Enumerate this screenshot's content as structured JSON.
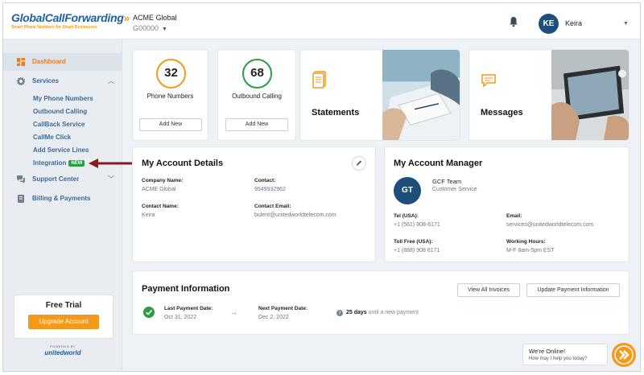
{
  "logo": {
    "name": "GlobalCallForwarding",
    "tagline": "Smart Phone Numbers for Smart Businesses"
  },
  "header": {
    "company_name": "ACME Global",
    "company_id": "G00000",
    "user_initials": "KE",
    "user_name": "Keira"
  },
  "sidebar": {
    "items": [
      {
        "label": "Dashboard",
        "icon": "dashboard-icon"
      },
      {
        "label": "Services",
        "icon": "gear-icon"
      },
      {
        "label": "Support Center",
        "icon": "chat-icon"
      },
      {
        "label": "Billing & Payments",
        "icon": "billing-icon"
      }
    ],
    "sub_items": [
      "My Phone Numbers",
      "Outbound Calling",
      "CallBack Service",
      "CallMe Click",
      "Add Service Lines",
      "Integration"
    ],
    "new_badge": "NEW",
    "trial_title": "Free Trial",
    "trial_button": "Upgrade Account",
    "powered_by": "POWERED BY",
    "powered_logo": "unitedworld"
  },
  "stats": [
    {
      "value": "32",
      "label": "Phone Numbers",
      "button": "Add New",
      "color": "#f39a1d"
    },
    {
      "value": "68",
      "label": "Outbound Calling",
      "button": "Add New",
      "color": "#2a9d45"
    }
  ],
  "features": [
    {
      "title": "Statements",
      "icon": "statements-icon"
    },
    {
      "title": "Messages",
      "icon": "messages-icon"
    }
  ],
  "account": {
    "title": "My Account Details",
    "company_label": "Company Name:",
    "company_value": "ACME Global",
    "contact_label": "Contact:",
    "contact_value": "9549932962",
    "contact_name_label": "Contact Name:",
    "contact_name_value": "Keira",
    "email_label": "Contact Email:",
    "email_value": "bulent@unitedworldtelecom.com"
  },
  "manager": {
    "title": "My Account Manager",
    "initials": "GT",
    "name": "GCF Team",
    "role": "Customer Service",
    "tel_label": "Tel (USA):",
    "tel_value": "+1 (561) 908-6171",
    "email_label": "Email:",
    "email_value": "services@unitedworldtelecom.com",
    "tollfree_label": "Toll Free (USA):",
    "tollfree_value": "+1 (888) 908 6171",
    "hours_label": "Working Hours:",
    "hours_value": "M-F 8am-5pm EST"
  },
  "payment": {
    "title": "Payment Information",
    "view_invoices": "View All Invoices",
    "update_payment": "Update Payment Information",
    "last_label": "Last Payment Date:",
    "last_value": "Oct 31, 2022",
    "next_label": "Next Payment Date:",
    "next_value": "Dec 2, 2022",
    "days": "25 days",
    "days_suffix": "until a new payment"
  },
  "chat": {
    "title": "We're Online!",
    "subtitle": "How may I help you today?"
  },
  "colors": {
    "accent": "#f39a1d",
    "brand": "#1f5f9e",
    "navy": "#1d4f7a",
    "success": "#2a9d45",
    "arrow": "#8b1a1a"
  }
}
